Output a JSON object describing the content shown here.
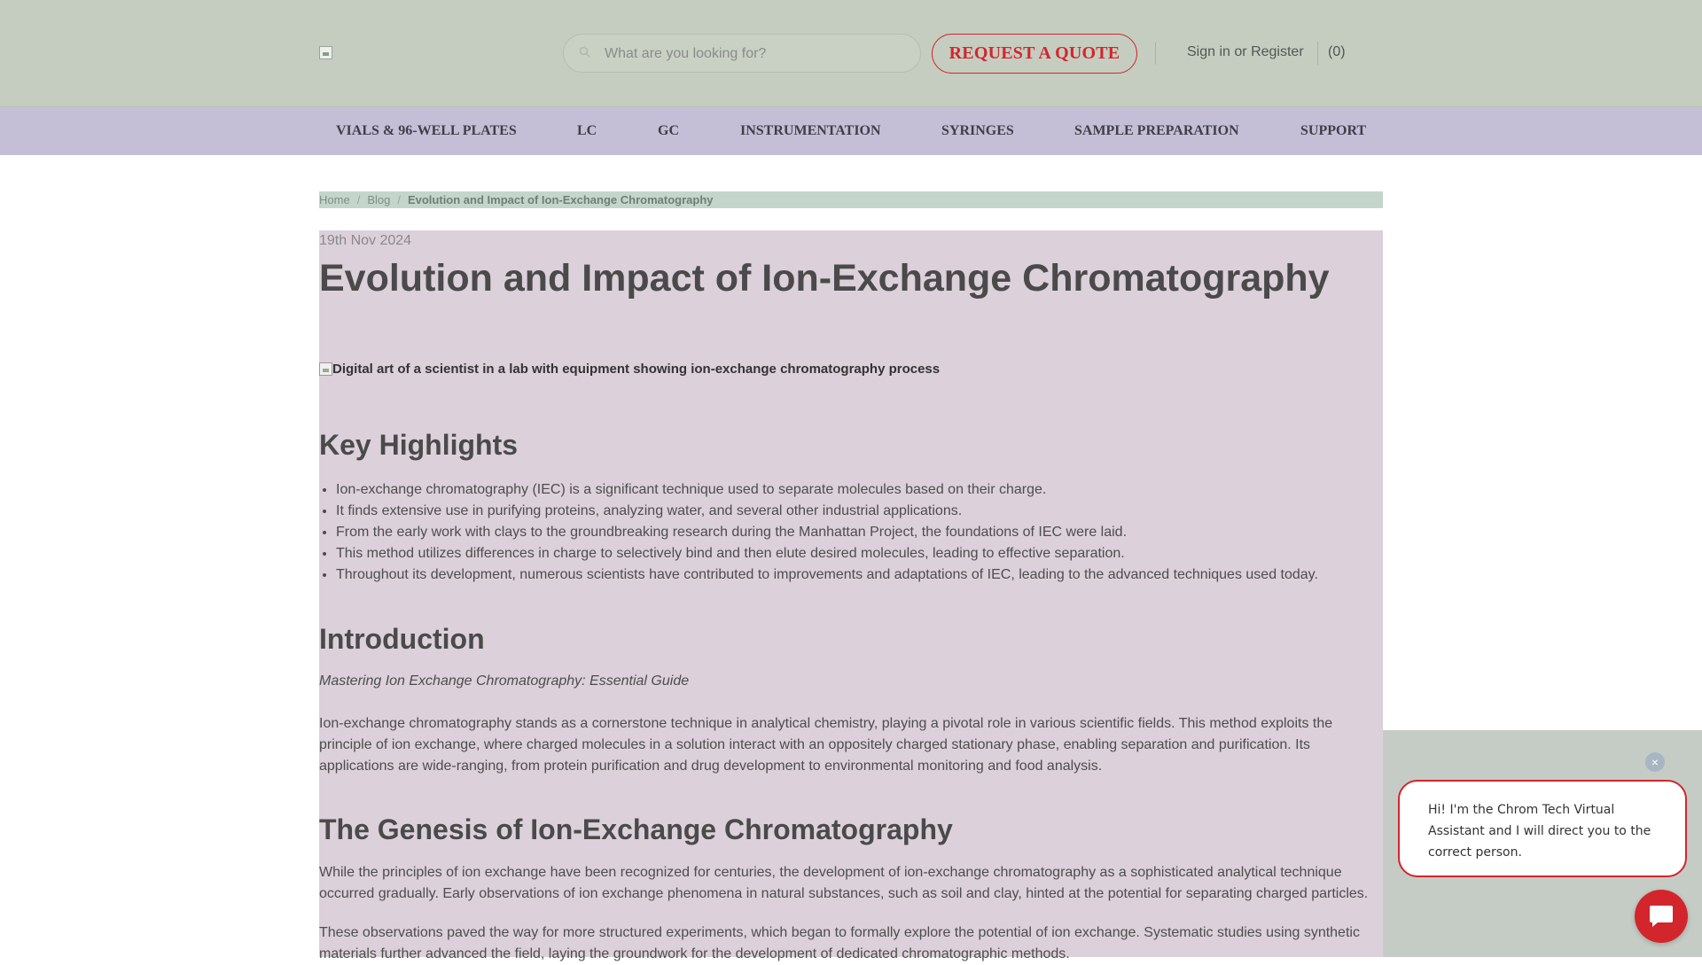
{
  "header": {
    "search_placeholder": "What are you looking for?",
    "quote_button": "REQUEST A QUOTE",
    "sign_in": "Sign in",
    "or": "or",
    "register": "Register",
    "cart_count": "(0)"
  },
  "nav": {
    "items": [
      "VIALS & 96-WELL PLATES",
      "LC",
      "GC",
      "INSTRUMENTATION",
      "SYRINGES",
      "SAMPLE PREPARATION",
      "SUPPORT"
    ]
  },
  "breadcrumb": {
    "home": "Home",
    "blog": "Blog",
    "current": "Evolution and Impact of Ion-Exchange Chromatography"
  },
  "article": {
    "date": "19th Nov 2024",
    "title": "Evolution and Impact of Ion-Exchange Chromatography",
    "hero_alt": "Digital art of a scientist in a lab with equipment showing ion-exchange chromatography process",
    "key_highlights_heading": "Key Highlights",
    "highlights": [
      "Ion-exchange chromatography (IEC) is a significant technique used to separate molecules based on their charge.",
      "It finds extensive use in purifying proteins, analyzing water, and several other industrial applications.",
      "From the early work with clays to the groundbreaking research during the Manhattan Project, the foundations of IEC were laid.",
      "This method utilizes differences in charge to selectively bind and then elute desired molecules, leading to effective separation.",
      "Throughout its development, numerous scientists have contributed to improvements and adaptations of IEC, leading to the advanced techniques used today."
    ],
    "intro_heading": "Introduction",
    "intro_italic": "Mastering Ion Exchange Chromatography: Essential Guide",
    "intro_paragraph": "Ion-exchange chromatography stands as a cornerstone technique in analytical chemistry, playing a pivotal role in various scientific fields. This method exploits the principle of ion exchange, where charged molecules in a solution interact with an oppositely charged stationary phase, enabling separation and purification. Its applications are wide-ranging, from protein purification and drug development to environmental monitoring and food analysis.",
    "genesis_heading": "The Genesis of Ion-Exchange Chromatography",
    "genesis_paragraph_1": "While the principles of ion exchange have been recognized for centuries, the development of ion-exchange chromatography as a sophisticated analytical technique occurred gradually. Early observations of ion exchange phenomena in natural substances, such as soil and clay, hinted at the potential for separating charged particles.",
    "genesis_paragraph_2": "These observations paved the way for more structured experiments, which began to formally explore the potential of ion exchange. Systematic studies using synthetic materials further advanced the field, laying the groundwork for the development of dedicated chromatographic methods."
  },
  "chat": {
    "close": "×",
    "message": "Hi! I'm the Chrom Tech Virtual Assistant and I will direct you to the correct person."
  },
  "colors": {
    "header_bg": "#c5cdc0",
    "nav_bg": "#c4bfd6",
    "article_bg": "#dcd0da",
    "accent_red": "#d2262c"
  }
}
